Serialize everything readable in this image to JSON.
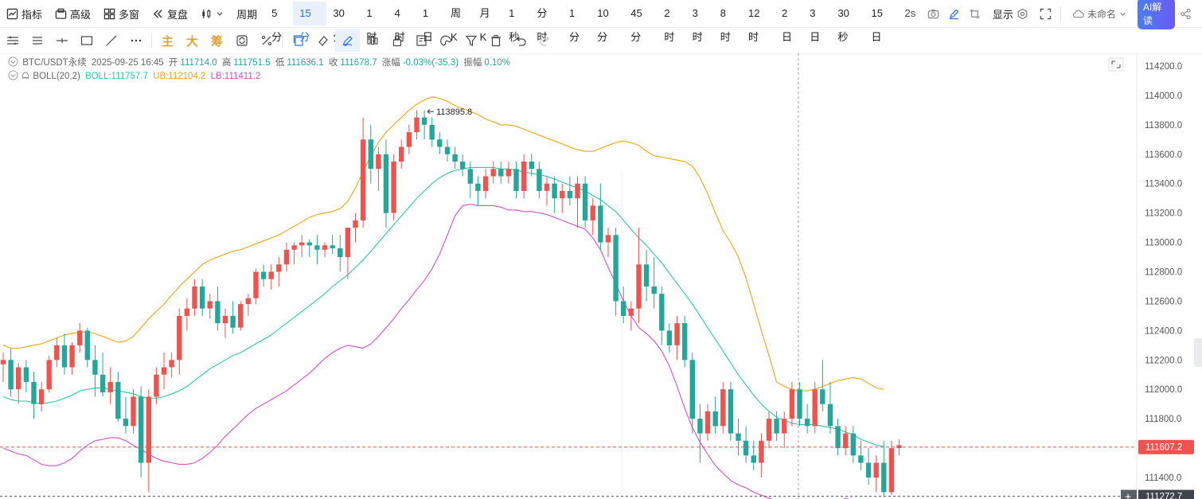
{
  "toolbar": {
    "indicator_label": "指标",
    "advanced_label": "高级",
    "multiwin_label": "多窗",
    "replay_label": "复盘",
    "period_label": "周期",
    "periods": [
      "5分",
      "15分",
      "30分",
      "1时",
      "4时",
      "1日",
      "周K",
      "月K",
      "1秒",
      "分时",
      "1分",
      "10分",
      "45分",
      "2时",
      "3时",
      "8时",
      "12时",
      "2日",
      "3日",
      "30秒",
      "15日"
    ],
    "active_period": "15分",
    "refresh": "2s",
    "display_label": "显示",
    "unnamed_label": "未命名",
    "ai_label": "AI解读"
  },
  "drawbar": {
    "main": "主",
    "big": "大",
    "chip": "筹"
  },
  "info": {
    "symbol": "BTC/USDT永续",
    "datetime": "2025-09-25 16:45",
    "open_label": "开",
    "open": "111714.0",
    "high_label": "高",
    "high": "111751.5",
    "low_label": "低",
    "low": "111636.1",
    "close_label": "收",
    "close": "111678.7",
    "change_label": "涨幅",
    "change": "-0.03%(-35.3)",
    "amp_label": "振幅",
    "amp": "0.10%"
  },
  "boll": {
    "name": "BOLL(20,2)",
    "mid": "BOLL:111757.7",
    "ub": "UB:112104.2",
    "lb": "LB:111411.2"
  },
  "colors": {
    "up": "#ef5350",
    "down": "#26a69a",
    "mid": "#2ec7a6",
    "ub": "#f0a312",
    "lb": "#d44fc8",
    "accent": "#2a6dd9"
  },
  "price_tag": "111607.2",
  "bottom_tag": "111272.7",
  "high_marker": "113895.8",
  "chart_data": {
    "type": "candlestick",
    "y_ticks": [
      "114200.0",
      "114000.0",
      "113800.0",
      "113600.0",
      "113400.0",
      "113200.0",
      "113000.0",
      "112800.0",
      "112600.0",
      "112400.0",
      "112200.0",
      "112000.0",
      "111800.0",
      "111400.0"
    ],
    "ylim": [
      111270,
      114330
    ],
    "candles": [
      [
        112170,
        112250,
        112050,
        112200
      ],
      [
        112200,
        112280,
        111950,
        112000
      ],
      [
        112000,
        112180,
        111900,
        112150
      ],
      [
        112150,
        112200,
        111980,
        112050
      ],
      [
        112050,
        112120,
        111800,
        111900
      ],
      [
        111900,
        112050,
        111850,
        112000
      ],
      [
        112000,
        112230,
        111980,
        112200
      ],
      [
        112200,
        112350,
        112150,
        112300
      ],
      [
        112300,
        112380,
        112100,
        112150
      ],
      [
        112150,
        112320,
        112100,
        112300
      ],
      [
        112300,
        112450,
        112250,
        112400
      ],
      [
        112400,
        112420,
        112150,
        112200
      ],
      [
        112200,
        112300,
        111950,
        112100
      ],
      [
        112100,
        112250,
        111950,
        111980
      ],
      [
        111980,
        112150,
        111900,
        112050
      ],
      [
        112050,
        112120,
        111780,
        111800
      ],
      [
        111800,
        111950,
        111700,
        111750
      ],
      [
        111750,
        112000,
        111700,
        111950
      ],
      [
        111950,
        112020,
        111400,
        111500
      ],
      [
        111500,
        112000,
        111300,
        111950
      ],
      [
        111950,
        112150,
        111900,
        112100
      ],
      [
        112100,
        112250,
        112000,
        112150
      ],
      [
        112150,
        112250,
        112080,
        112200
      ],
      [
        112200,
        112550,
        112100,
        112500
      ],
      [
        112500,
        112620,
        112400,
        112550
      ],
      [
        112550,
        112750,
        112500,
        112700
      ],
      [
        112700,
        112750,
        112500,
        112550
      ],
      [
        112550,
        112650,
        112480,
        112600
      ],
      [
        112600,
        112700,
        112400,
        112450
      ],
      [
        112450,
        112550,
        112350,
        112500
      ],
      [
        112500,
        112600,
        112380,
        112420
      ],
      [
        112420,
        112600,
        112400,
        112580
      ],
      [
        112580,
        112650,
        112500,
        112620
      ],
      [
        112620,
        112820,
        112580,
        112800
      ],
      [
        112800,
        112850,
        112700,
        112750
      ],
      [
        112750,
        112850,
        112680,
        112800
      ],
      [
        112800,
        112900,
        112700,
        112850
      ],
      [
        112850,
        113000,
        112800,
        112950
      ],
      [
        112950,
        113000,
        112850,
        112980
      ],
      [
        112980,
        113050,
        112900,
        113000
      ],
      [
        113000,
        113020,
        112900,
        112980
      ],
      [
        112980,
        113050,
        112850,
        112950
      ],
      [
        112950,
        113000,
        112900,
        112980
      ],
      [
        112980,
        113050,
        112920,
        112960
      ],
      [
        112960,
        113050,
        112800,
        112900
      ],
      [
        112900,
        113100,
        112750,
        113100
      ],
      [
        113100,
        113200,
        113000,
        113150
      ],
      [
        113150,
        113850,
        113100,
        113700
      ],
      [
        113700,
        113800,
        113400,
        113500
      ],
      [
        113500,
        113650,
        113350,
        113600
      ],
      [
        113600,
        113700,
        113100,
        113200
      ],
      [
        113200,
        113600,
        113150,
        113550
      ],
      [
        113550,
        113700,
        113500,
        113650
      ],
      [
        113650,
        113800,
        113600,
        113750
      ],
      [
        113750,
        113900,
        113700,
        113850
      ],
      [
        113850,
        113900,
        113700,
        113800
      ],
      [
        113800,
        113850,
        113650,
        113700
      ],
      [
        113700,
        113750,
        113600,
        113650
      ],
      [
        113650,
        113700,
        113550,
        113600
      ],
      [
        113600,
        113650,
        113500,
        113550
      ],
      [
        113550,
        113600,
        113450,
        113500
      ],
      [
        113500,
        113550,
        113300,
        113400
      ],
      [
        113400,
        113450,
        113250,
        113350
      ],
      [
        113350,
        113500,
        113300,
        113450
      ],
      [
        113450,
        113550,
        113400,
        113500
      ],
      [
        113500,
        113550,
        113400,
        113450
      ],
      [
        113450,
        113550,
        113400,
        113500
      ],
      [
        113500,
        113550,
        113300,
        113350
      ],
      [
        113350,
        113600,
        113300,
        113550
      ],
      [
        113550,
        113600,
        113450,
        113500
      ],
      [
        113500,
        113550,
        113300,
        113350
      ],
      [
        113350,
        113450,
        113250,
        113400
      ],
      [
        113400,
        113450,
        113200,
        113300
      ],
      [
        113300,
        113400,
        113200,
        113350
      ],
      [
        113350,
        113450,
        113250,
        113300
      ],
      [
        113300,
        113450,
        113100,
        113400
      ],
      [
        113400,
        113450,
        113100,
        113150
      ],
      [
        113150,
        113300,
        113050,
        113250
      ],
      [
        113250,
        113400,
        112950,
        113000
      ],
      [
        113000,
        113100,
        112900,
        113050
      ],
      [
        113050,
        113100,
        112500,
        112600
      ],
      [
        112600,
        112700,
        112450,
        112500
      ],
      [
        112500,
        112600,
        112400,
        112550
      ],
      [
        112550,
        113100,
        112450,
        112850
      ],
      [
        112850,
        112950,
        112600,
        112700
      ],
      [
        112700,
        112900,
        112550,
        112650
      ],
      [
        112650,
        112700,
        112300,
        112400
      ],
      [
        112400,
        112450,
        112250,
        112300
      ],
      [
        112300,
        112500,
        112200,
        112450
      ],
      [
        112450,
        112500,
        112150,
        112200
      ],
      [
        112200,
        112250,
        111700,
        111800
      ],
      [
        111800,
        111900,
        111500,
        111700
      ],
      [
        111700,
        111900,
        111650,
        111850
      ],
      [
        111850,
        111950,
        111700,
        111750
      ],
      [
        111750,
        112050,
        111700,
        112000
      ],
      [
        112000,
        112050,
        111650,
        111700
      ],
      [
        111700,
        111800,
        111550,
        111650
      ],
      [
        111650,
        111750,
        111500,
        111550
      ],
      [
        111550,
        111650,
        111450,
        111500
      ],
      [
        111500,
        111700,
        111400,
        111650
      ],
      [
        111650,
        111850,
        111600,
        111800
      ],
      [
        111800,
        111850,
        111650,
        111700
      ],
      [
        111700,
        111850,
        111600,
        111800
      ],
      [
        111800,
        112050,
        111750,
        112000
      ],
      [
        112000,
        112050,
        111750,
        111800
      ],
      [
        111800,
        111900,
        111700,
        111750
      ],
      [
        111750,
        112050,
        111700,
        112000
      ],
      [
        112000,
        112200,
        111850,
        111900
      ],
      [
        111900,
        112050,
        111700,
        111750
      ],
      [
        111750,
        111800,
        111550,
        111600
      ],
      [
        111600,
        111750,
        111550,
        111700
      ],
      [
        111700,
        111750,
        111500,
        111550
      ],
      [
        111550,
        111650,
        111450,
        111500
      ],
      [
        111500,
        111600,
        111350,
        111400
      ],
      [
        111400,
        111550,
        111300,
        111500
      ],
      [
        111500,
        111650,
        111270,
        111300
      ],
      [
        111300,
        111650,
        111280,
        111600
      ],
      [
        111600,
        111660,
        111550,
        111620
      ]
    ],
    "boll_mid": [
      111950,
      111930,
      111920,
      111920,
      111910,
      111900,
      111910,
      111920,
      111940,
      111960,
      111990,
      112000,
      112010,
      112010,
      112000,
      111990,
      111980,
      111970,
      111950,
      111940,
      111940,
      111950,
      111970,
      111990,
      112020,
      112060,
      112100,
      112140,
      112170,
      112200,
      112230,
      112250,
      112280,
      112310,
      112340,
      112370,
      112410,
      112450,
      112490,
      112530,
      112570,
      112610,
      112650,
      112700,
      112740,
      112780,
      112830,
      112880,
      112940,
      113000,
      113060,
      113120,
      113180,
      113240,
      113300,
      113350,
      113400,
      113440,
      113470,
      113490,
      113500,
      113510,
      113510,
      113510,
      113510,
      113500,
      113500,
      113490,
      113480,
      113470,
      113460,
      113450,
      113430,
      113410,
      113390,
      113370,
      113350,
      113320,
      113290,
      113250,
      113210,
      113150,
      113090,
      113030,
      112980,
      112920,
      112860,
      112790,
      112720,
      112650,
      112580,
      112500,
      112420,
      112340,
      112260,
      112180,
      112100,
      112030,
      111960,
      111900,
      111850,
      111810,
      111790,
      111770,
      111760,
      111760,
      111760,
      111750,
      111740,
      111730,
      111710,
      111690,
      111660,
      111640,
      111620,
      111610
    ],
    "boll_ub": [
      112300,
      112280,
      112280,
      112290,
      112300,
      112310,
      112330,
      112350,
      112370,
      112380,
      112390,
      112390,
      112380,
      112360,
      112340,
      112320,
      112330,
      112360,
      112420,
      112480,
      112530,
      112580,
      112640,
      112700,
      112750,
      112800,
      112850,
      112880,
      112900,
      112920,
      112940,
      112950,
      112970,
      112990,
      113010,
      113030,
      113050,
      113080,
      113110,
      113140,
      113170,
      113190,
      113200,
      113210,
      113230,
      113280,
      113370,
      113480,
      113590,
      113680,
      113750,
      113800,
      113850,
      113900,
      113940,
      113970,
      113990,
      113980,
      113960,
      113930,
      113910,
      113890,
      113870,
      113840,
      113820,
      113800,
      113800,
      113790,
      113770,
      113750,
      113730,
      113710,
      113690,
      113670,
      113650,
      113630,
      113620,
      113620,
      113640,
      113660,
      113680,
      113690,
      113680,
      113660,
      113620,
      113590,
      113580,
      113570,
      113560,
      113550,
      113520,
      113440,
      113330,
      113200,
      113080,
      113000,
      112900,
      112760,
      112580,
      112400,
      112230,
      112050,
      112020,
      112000,
      111990,
      111990,
      112000,
      112020,
      112040,
      112060,
      112070,
      112080,
      112070,
      112040,
      112010,
      112000
    ],
    "boll_lb": [
      111600,
      111580,
      111560,
      111550,
      111520,
      111490,
      111480,
      111480,
      111500,
      111530,
      111580,
      111620,
      111650,
      111660,
      111670,
      111670,
      111650,
      111620,
      111590,
      111560,
      111530,
      111510,
      111500,
      111490,
      111490,
      111500,
      111530,
      111570,
      111620,
      111680,
      111730,
      111780,
      111830,
      111870,
      111900,
      111930,
      111960,
      111990,
      112030,
      112070,
      112110,
      112160,
      112210,
      112250,
      112280,
      112300,
      112290,
      112280,
      112310,
      112360,
      112420,
      112480,
      112550,
      112610,
      112680,
      112740,
      112820,
      112920,
      113050,
      113180,
      113250,
      113260,
      113250,
      113250,
      113250,
      113240,
      113220,
      113220,
      113210,
      113210,
      113200,
      113190,
      113170,
      113150,
      113130,
      113110,
      113090,
      113030,
      112950,
      112830,
      112720,
      112600,
      112500,
      112420,
      112380,
      112330,
      112260,
      112160,
      112020,
      111870,
      111740,
      111640,
      111560,
      111480,
      111430,
      111380,
      111350,
      111330,
      111300,
      111280,
      111260,
      111240,
      111200,
      111160,
      111120,
      111090,
      111090,
      111120,
      111170,
      111220,
      111260,
      111240,
      111200,
      111180,
      111160,
      111150
    ]
  }
}
